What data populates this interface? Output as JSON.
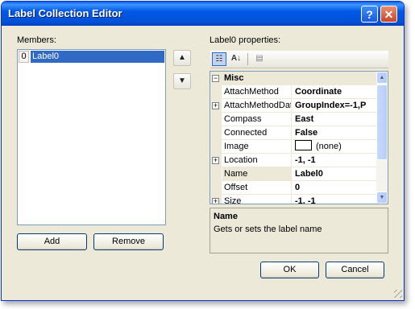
{
  "window": {
    "title": "Label Collection Editor",
    "help_label": "?",
    "close_label": "✕"
  },
  "members": {
    "label": "Members:",
    "items": [
      {
        "index": "0",
        "name": "Label0"
      }
    ],
    "up_icon": "up-arrow-icon",
    "down_icon": "down-arrow-icon"
  },
  "buttons": {
    "add": "Add",
    "remove": "Remove",
    "ok": "OK",
    "cancel": "Cancel"
  },
  "properties": {
    "label": "Label0 properties:",
    "category": "Misc",
    "rows": [
      {
        "name": "AttachMethod",
        "value": "Coordinate",
        "expandable": false
      },
      {
        "name": "AttachMethodDat",
        "value": "GroupIndex=-1,P",
        "expandable": true
      },
      {
        "name": "Compass",
        "value": "East",
        "expandable": false
      },
      {
        "name": "Connected",
        "value": "False",
        "expandable": false
      },
      {
        "name": "Image",
        "value": "(none)",
        "expandable": false
      },
      {
        "name": "Location",
        "value": "-1, -1",
        "expandable": true
      },
      {
        "name": "Name",
        "value": "Label0",
        "expandable": false,
        "selected": true
      },
      {
        "name": "Offset",
        "value": "0",
        "expandable": false
      },
      {
        "name": "Size",
        "value": "-1, -1",
        "expandable": true
      }
    ],
    "toolbar_icons": [
      "categorized-icon",
      "alphabetical-icon",
      "property-pages-icon"
    ],
    "alpha_label": "A↓"
  },
  "description": {
    "title": "Name",
    "text": "Gets or sets the label name"
  },
  "colors": {
    "title_bar": "#0058e6",
    "selection": "#316ac5",
    "dialog_bg": "#ece9d8"
  }
}
